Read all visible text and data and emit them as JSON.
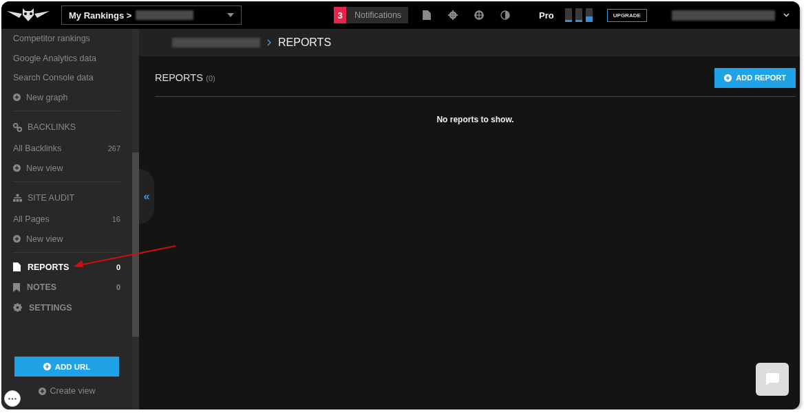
{
  "topbar": {
    "project_selector": {
      "label": "My Rankings >"
    },
    "notifications": {
      "count": "3",
      "label": "Notifications"
    },
    "plan": "Pro",
    "usage_meter": [
      {
        "level": 0.15
      },
      {
        "level": 0.15
      },
      {
        "level": 0.4
      }
    ],
    "upgrade_button": "UPGRADE"
  },
  "sidebar": {
    "items": [
      {
        "kind": "link",
        "label": "Competitor rankings"
      },
      {
        "kind": "link",
        "label": "Google Analytics data"
      },
      {
        "kind": "link",
        "label": "Search Console data"
      },
      {
        "kind": "add",
        "label": "New graph"
      },
      {
        "kind": "section",
        "label": "BACKLINKS"
      },
      {
        "kind": "count",
        "label": "All Backlinks",
        "count": "267"
      },
      {
        "kind": "add",
        "label": "New view"
      },
      {
        "kind": "section",
        "label": "SITE AUDIT"
      },
      {
        "kind": "count",
        "label": "All Pages",
        "count": "16"
      },
      {
        "kind": "add",
        "label": "New view"
      }
    ],
    "nav": [
      {
        "label": "REPORTS",
        "count": "0",
        "selected": true
      },
      {
        "label": "NOTES",
        "count": "0",
        "selected": false
      },
      {
        "label": "SETTINGS",
        "selected": false
      }
    ],
    "add_url_button": "ADD URL",
    "create_view": "Create view",
    "collapse": "«"
  },
  "breadcrumb": {
    "current": "REPORTS"
  },
  "reports": {
    "title": "REPORTS",
    "count": "(0)",
    "add_button": "ADD REPORT",
    "empty_message": "No reports to show."
  }
}
